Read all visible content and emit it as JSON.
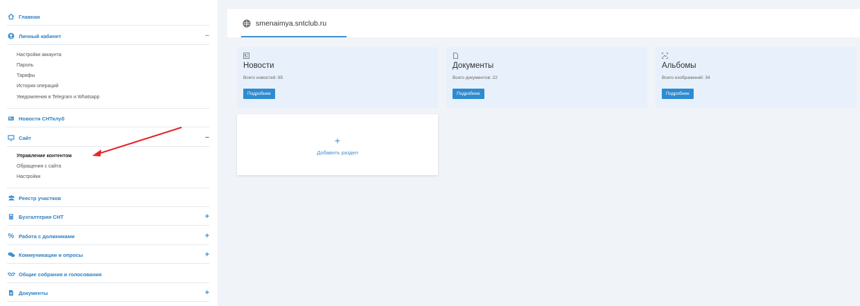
{
  "sidebar": {
    "home": "Главная",
    "cabinet": {
      "label": "Личный кабинет",
      "toggle": "−",
      "items": [
        "Настройки аккаунта",
        "Пароль",
        "Тарифы",
        "История операций",
        "Уведомления в Telegram и Whatsapp"
      ]
    },
    "news": "Новости СНТклуб",
    "site": {
      "label": "Сайт",
      "toggle": "−",
      "items": [
        "Управление контентом",
        "Обращения с сайта",
        "Настройки"
      ]
    },
    "registry": "Реестр участков",
    "accounting": {
      "label": "Бухгалтерия СНТ",
      "toggle": "+"
    },
    "debtors": {
      "label": "Работа с должниками",
      "toggle": "+"
    },
    "communications": {
      "label": "Коммуникации и опросы",
      "toggle": "+"
    },
    "meetings": "Общие собрания и голосования",
    "documents": {
      "label": "Документы",
      "toggle": "+"
    }
  },
  "main": {
    "domain": "smenaimya.sntclub.ru",
    "cards": [
      {
        "icon": "news-icon",
        "title": "Новости",
        "subtitle": "Всего новостей: 85",
        "button": "Подробнее"
      },
      {
        "icon": "document-icon",
        "title": "Документы",
        "subtitle": "Всего документов: 22",
        "button": "Подробнее"
      },
      {
        "icon": "album-icon",
        "title": "Альбомы",
        "subtitle": "Всего изображений: 34",
        "button": "Подробнее"
      }
    ],
    "add_section": {
      "plus": "+",
      "label": "Добавить раздел"
    }
  },
  "colors": {
    "accent": "#2e8bd0",
    "link": "#2d7fc4",
    "card_bg": "#e8f1fb",
    "annotation_arrow": "#e5262b"
  }
}
